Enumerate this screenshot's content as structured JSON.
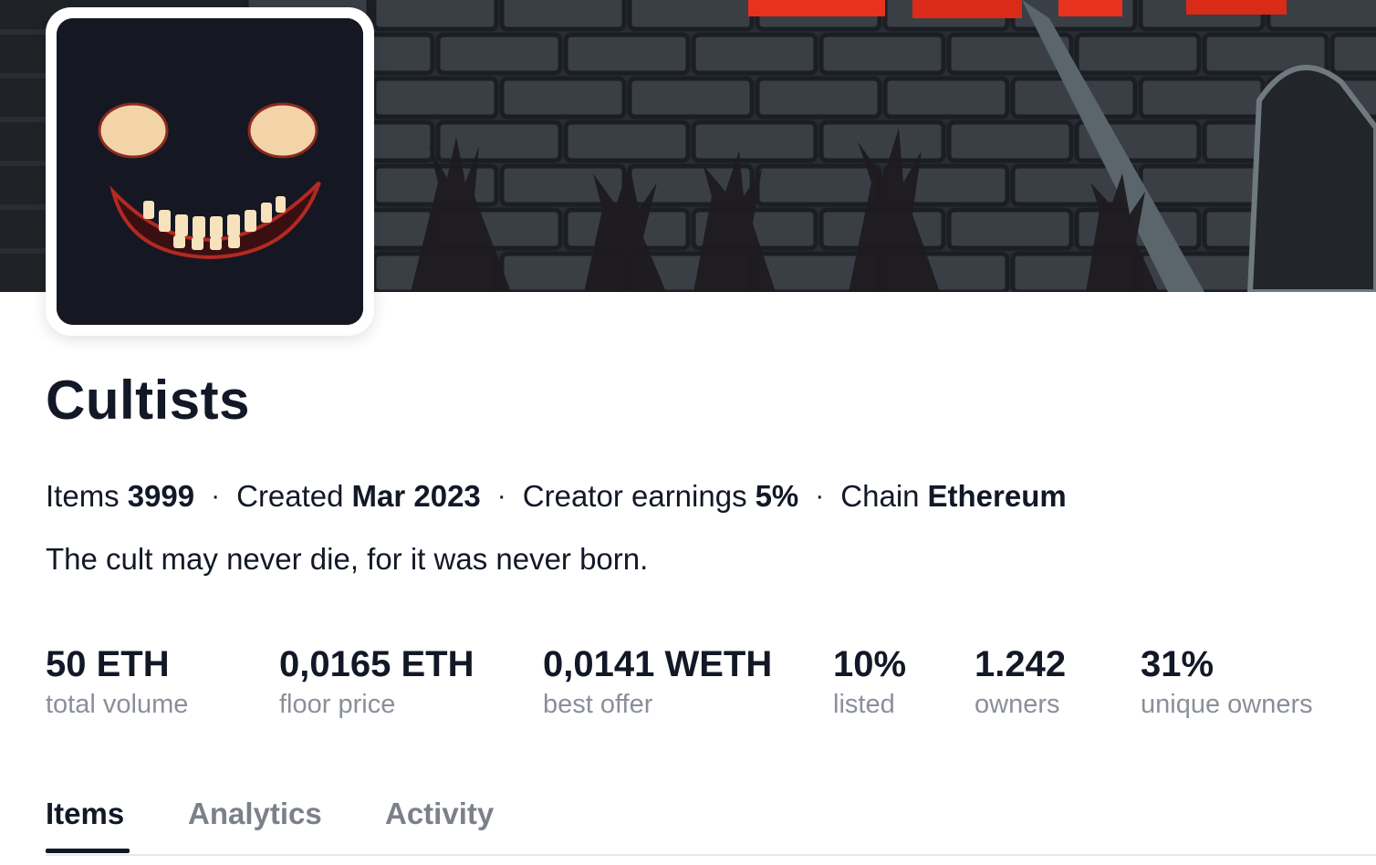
{
  "collection": {
    "name": "Cultists",
    "description": "The cult may never die, for it was never born."
  },
  "meta": [
    {
      "label": "Items",
      "value": "3999"
    },
    {
      "label": "Created",
      "value": "Mar 2023"
    },
    {
      "label": "Creator earnings",
      "value": "5%"
    },
    {
      "label": "Chain",
      "value": "Ethereum"
    }
  ],
  "separator": "·",
  "stats": [
    {
      "value": "50 ETH",
      "label": "total volume"
    },
    {
      "value": "0,0165 ETH",
      "label": "floor price"
    },
    {
      "value": "0,0141 WETH",
      "label": "best offer"
    },
    {
      "value": "10%",
      "label": "listed"
    },
    {
      "value": "1.242",
      "label": "owners"
    },
    {
      "value": "31%",
      "label": "unique owners"
    }
  ],
  "tabs": [
    {
      "label": "Items",
      "active": true
    },
    {
      "label": "Analytics",
      "active": false
    },
    {
      "label": "Activity",
      "active": false
    }
  ],
  "colors": {
    "text_primary": "#121826",
    "text_muted": "#8a8f99",
    "avatar_bg": "#151723",
    "banner_bg": "#2b2f36",
    "banner_accent": "#e8321e"
  }
}
